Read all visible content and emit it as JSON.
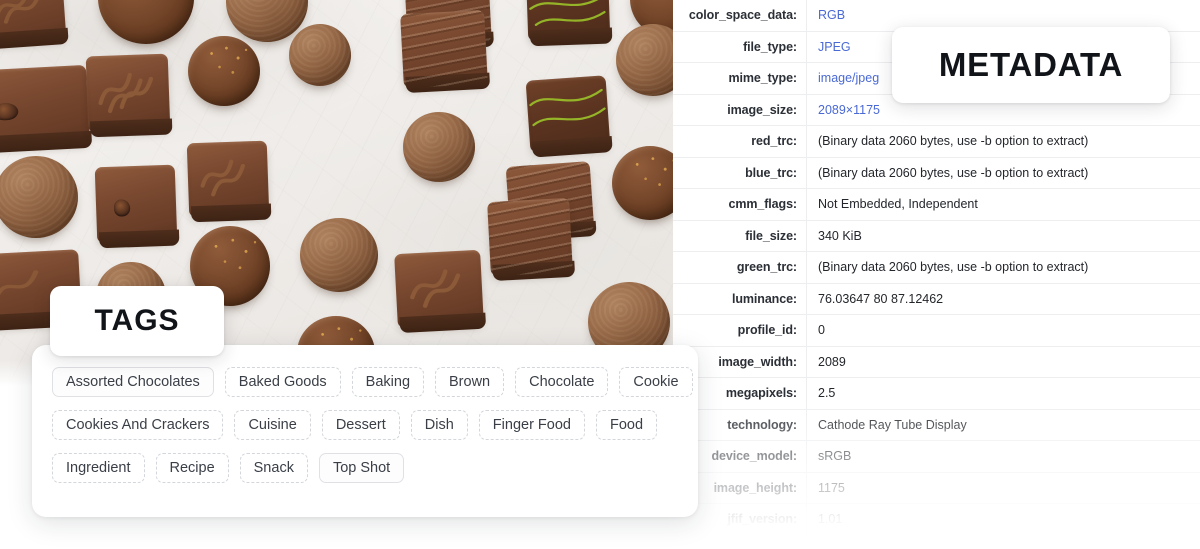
{
  "tags_section": {
    "badge_label": "TAGS",
    "rows": [
      [
        {
          "label": "Assorted Chocolates",
          "style": "solid"
        },
        {
          "label": "Baked Goods",
          "style": "dashed"
        },
        {
          "label": "Baking",
          "style": "dashed"
        },
        {
          "label": "Brown",
          "style": "dashed"
        },
        {
          "label": "Chocolate",
          "style": "dashed"
        },
        {
          "label": "Cookie",
          "style": "dashed"
        }
      ],
      [
        {
          "label": "Cookies And Crackers",
          "style": "dashed"
        },
        {
          "label": "Cuisine",
          "style": "dashed"
        },
        {
          "label": "Dessert",
          "style": "dashed"
        },
        {
          "label": "Dish",
          "style": "dashed"
        },
        {
          "label": "Finger Food",
          "style": "dashed"
        },
        {
          "label": "Food",
          "style": "dashed"
        }
      ],
      [
        {
          "label": "Ingredient",
          "style": "dashed"
        },
        {
          "label": "Recipe",
          "style": "dashed"
        },
        {
          "label": "Snack",
          "style": "dashed"
        },
        {
          "label": "Top Shot",
          "style": "solid"
        }
      ]
    ]
  },
  "metadata_section": {
    "badge_label": "METADATA",
    "rows": [
      {
        "key": "color_space_data:",
        "value": "RGB",
        "link": true,
        "opacity": 1
      },
      {
        "key": "file_type:",
        "value": "JPEG",
        "link": true,
        "opacity": 1
      },
      {
        "key": "mime_type:",
        "value": "image/jpeg",
        "link": true,
        "opacity": 1
      },
      {
        "key": "image_size:",
        "value": "2089×1175",
        "link": true,
        "opacity": 1
      },
      {
        "key": "red_trc:",
        "value": "(Binary data 2060 bytes, use -b option to extract)",
        "link": false,
        "opacity": 1
      },
      {
        "key": "blue_trc:",
        "value": "(Binary data 2060 bytes, use -b option to extract)",
        "link": false,
        "opacity": 1
      },
      {
        "key": "cmm_flags:",
        "value": "Not Embedded, Independent",
        "link": false,
        "opacity": 1
      },
      {
        "key": "file_size:",
        "value": "340 KiB",
        "link": false,
        "opacity": 1
      },
      {
        "key": "green_trc:",
        "value": "(Binary data 2060 bytes, use -b option to extract)",
        "link": false,
        "opacity": 1
      },
      {
        "key": "luminance:",
        "value": "76.03647 80 87.12462",
        "link": false,
        "opacity": 1
      },
      {
        "key": "profile_id:",
        "value": "0",
        "link": false,
        "opacity": 1
      },
      {
        "key": "image_width:",
        "value": "2089",
        "link": false,
        "opacity": 1
      },
      {
        "key": "megapixels:",
        "value": "2.5",
        "link": false,
        "opacity": 1
      },
      {
        "key": "technology:",
        "value": "Cathode Ray Tube Display",
        "link": false,
        "opacity": 1
      },
      {
        "key": "device_model:",
        "value": "sRGB",
        "link": false,
        "opacity": 1
      },
      {
        "key": "image_height:",
        "value": "1175",
        "link": false,
        "opacity": 1
      },
      {
        "key": "jfif_version:",
        "value": "1.01",
        "link": false,
        "opacity": 1
      }
    ]
  },
  "photo": {
    "alt": "assorted chocolates on white marble surface"
  },
  "colors": {
    "link": "#4a69d4",
    "key_text": "#2b2f36",
    "value_text": "#23262b",
    "chip_border_dashed": "#d3d6da",
    "chip_border_solid": "#dfe1e4",
    "row_divider": "#edeef0",
    "panel_bg": "#ffffff"
  }
}
